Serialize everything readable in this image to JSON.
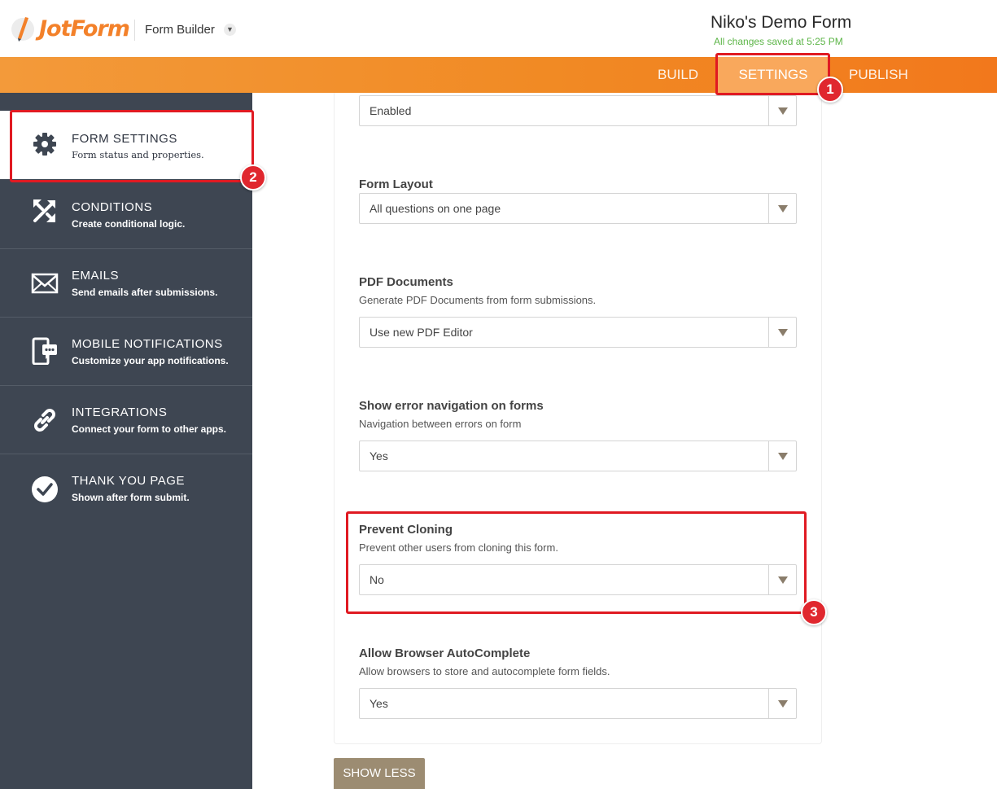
{
  "header": {
    "logo_text": "JotForm",
    "builder_label": "Form Builder",
    "form_title": "Niko's Demo Form",
    "save_status": "All changes saved at 5:25 PM"
  },
  "nav": {
    "tabs": [
      {
        "label": "BUILD",
        "icon": ""
      },
      {
        "label": "SETTINGS",
        "active": true
      },
      {
        "label": "PUBLISH"
      }
    ]
  },
  "sidebar": {
    "items": [
      {
        "title": "FORM SETTINGS",
        "desc": "Form status and properties.",
        "icon": "gear-icon",
        "active": true
      },
      {
        "title": "CONDITIONS",
        "desc": "Create conditional logic.",
        "icon": "conditions-icon"
      },
      {
        "title": "EMAILS",
        "desc": "Send emails after submissions.",
        "icon": "envelope-icon"
      },
      {
        "title": "MOBILE NOTIFICATIONS",
        "desc": "Customize your app notifications.",
        "icon": "mobile-notification-icon"
      },
      {
        "title": "INTEGRATIONS",
        "desc": "Connect your form to other apps.",
        "icon": "link-icon"
      },
      {
        "title": "THANK YOU PAGE",
        "desc": "Shown after form submit.",
        "icon": "checkmark-circle-icon"
      }
    ]
  },
  "settings": {
    "top_select": {
      "value": "Enabled"
    },
    "form_layout": {
      "label": "Form Layout",
      "value": "All questions on one page"
    },
    "pdf_documents": {
      "label": "PDF Documents",
      "desc": "Generate PDF Documents from form submissions.",
      "value": "Use new PDF Editor"
    },
    "error_navigation": {
      "label": "Show error navigation on forms",
      "desc": "Navigation between errors on form",
      "value": "Yes"
    },
    "prevent_cloning": {
      "label": "Prevent Cloning",
      "desc": "Prevent other users from cloning this form.",
      "value": "No"
    },
    "autocomplete": {
      "label": "Allow Browser AutoComplete",
      "desc": "Allow browsers to store and autocomplete form fields.",
      "value": "Yes"
    }
  },
  "show_less_label": "SHOW LESS",
  "annotations": {
    "badge1": "1",
    "badge2": "2",
    "badge3": "3",
    "color": "#e01a22"
  }
}
